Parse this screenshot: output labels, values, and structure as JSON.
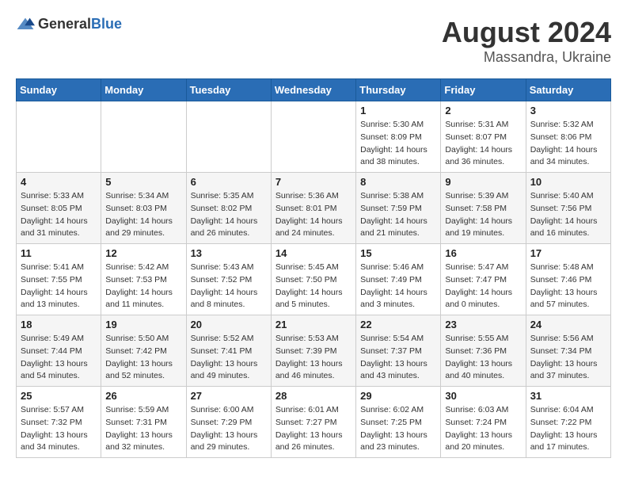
{
  "header": {
    "logo_general": "General",
    "logo_blue": "Blue",
    "month_year": "August 2024",
    "location": "Massandra, Ukraine"
  },
  "weekdays": [
    "Sunday",
    "Monday",
    "Tuesday",
    "Wednesday",
    "Thursday",
    "Friday",
    "Saturday"
  ],
  "weeks": [
    [
      {
        "day": "",
        "sunrise": "",
        "sunset": "",
        "daylight": ""
      },
      {
        "day": "",
        "sunrise": "",
        "sunset": "",
        "daylight": ""
      },
      {
        "day": "",
        "sunrise": "",
        "sunset": "",
        "daylight": ""
      },
      {
        "day": "",
        "sunrise": "",
        "sunset": "",
        "daylight": ""
      },
      {
        "day": "1",
        "sunrise": "Sunrise: 5:30 AM",
        "sunset": "Sunset: 8:09 PM",
        "daylight": "Daylight: 14 hours and 38 minutes."
      },
      {
        "day": "2",
        "sunrise": "Sunrise: 5:31 AM",
        "sunset": "Sunset: 8:07 PM",
        "daylight": "Daylight: 14 hours and 36 minutes."
      },
      {
        "day": "3",
        "sunrise": "Sunrise: 5:32 AM",
        "sunset": "Sunset: 8:06 PM",
        "daylight": "Daylight: 14 hours and 34 minutes."
      }
    ],
    [
      {
        "day": "4",
        "sunrise": "Sunrise: 5:33 AM",
        "sunset": "Sunset: 8:05 PM",
        "daylight": "Daylight: 14 hours and 31 minutes."
      },
      {
        "day": "5",
        "sunrise": "Sunrise: 5:34 AM",
        "sunset": "Sunset: 8:03 PM",
        "daylight": "Daylight: 14 hours and 29 minutes."
      },
      {
        "day": "6",
        "sunrise": "Sunrise: 5:35 AM",
        "sunset": "Sunset: 8:02 PM",
        "daylight": "Daylight: 14 hours and 26 minutes."
      },
      {
        "day": "7",
        "sunrise": "Sunrise: 5:36 AM",
        "sunset": "Sunset: 8:01 PM",
        "daylight": "Daylight: 14 hours and 24 minutes."
      },
      {
        "day": "8",
        "sunrise": "Sunrise: 5:38 AM",
        "sunset": "Sunset: 7:59 PM",
        "daylight": "Daylight: 14 hours and 21 minutes."
      },
      {
        "day": "9",
        "sunrise": "Sunrise: 5:39 AM",
        "sunset": "Sunset: 7:58 PM",
        "daylight": "Daylight: 14 hours and 19 minutes."
      },
      {
        "day": "10",
        "sunrise": "Sunrise: 5:40 AM",
        "sunset": "Sunset: 7:56 PM",
        "daylight": "Daylight: 14 hours and 16 minutes."
      }
    ],
    [
      {
        "day": "11",
        "sunrise": "Sunrise: 5:41 AM",
        "sunset": "Sunset: 7:55 PM",
        "daylight": "Daylight: 14 hours and 13 minutes."
      },
      {
        "day": "12",
        "sunrise": "Sunrise: 5:42 AM",
        "sunset": "Sunset: 7:53 PM",
        "daylight": "Daylight: 14 hours and 11 minutes."
      },
      {
        "day": "13",
        "sunrise": "Sunrise: 5:43 AM",
        "sunset": "Sunset: 7:52 PM",
        "daylight": "Daylight: 14 hours and 8 minutes."
      },
      {
        "day": "14",
        "sunrise": "Sunrise: 5:45 AM",
        "sunset": "Sunset: 7:50 PM",
        "daylight": "Daylight: 14 hours and 5 minutes."
      },
      {
        "day": "15",
        "sunrise": "Sunrise: 5:46 AM",
        "sunset": "Sunset: 7:49 PM",
        "daylight": "Daylight: 14 hours and 3 minutes."
      },
      {
        "day": "16",
        "sunrise": "Sunrise: 5:47 AM",
        "sunset": "Sunset: 7:47 PM",
        "daylight": "Daylight: 14 hours and 0 minutes."
      },
      {
        "day": "17",
        "sunrise": "Sunrise: 5:48 AM",
        "sunset": "Sunset: 7:46 PM",
        "daylight": "Daylight: 13 hours and 57 minutes."
      }
    ],
    [
      {
        "day": "18",
        "sunrise": "Sunrise: 5:49 AM",
        "sunset": "Sunset: 7:44 PM",
        "daylight": "Daylight: 13 hours and 54 minutes."
      },
      {
        "day": "19",
        "sunrise": "Sunrise: 5:50 AM",
        "sunset": "Sunset: 7:42 PM",
        "daylight": "Daylight: 13 hours and 52 minutes."
      },
      {
        "day": "20",
        "sunrise": "Sunrise: 5:52 AM",
        "sunset": "Sunset: 7:41 PM",
        "daylight": "Daylight: 13 hours and 49 minutes."
      },
      {
        "day": "21",
        "sunrise": "Sunrise: 5:53 AM",
        "sunset": "Sunset: 7:39 PM",
        "daylight": "Daylight: 13 hours and 46 minutes."
      },
      {
        "day": "22",
        "sunrise": "Sunrise: 5:54 AM",
        "sunset": "Sunset: 7:37 PM",
        "daylight": "Daylight: 13 hours and 43 minutes."
      },
      {
        "day": "23",
        "sunrise": "Sunrise: 5:55 AM",
        "sunset": "Sunset: 7:36 PM",
        "daylight": "Daylight: 13 hours and 40 minutes."
      },
      {
        "day": "24",
        "sunrise": "Sunrise: 5:56 AM",
        "sunset": "Sunset: 7:34 PM",
        "daylight": "Daylight: 13 hours and 37 minutes."
      }
    ],
    [
      {
        "day": "25",
        "sunrise": "Sunrise: 5:57 AM",
        "sunset": "Sunset: 7:32 PM",
        "daylight": "Daylight: 13 hours and 34 minutes."
      },
      {
        "day": "26",
        "sunrise": "Sunrise: 5:59 AM",
        "sunset": "Sunset: 7:31 PM",
        "daylight": "Daylight: 13 hours and 32 minutes."
      },
      {
        "day": "27",
        "sunrise": "Sunrise: 6:00 AM",
        "sunset": "Sunset: 7:29 PM",
        "daylight": "Daylight: 13 hours and 29 minutes."
      },
      {
        "day": "28",
        "sunrise": "Sunrise: 6:01 AM",
        "sunset": "Sunset: 7:27 PM",
        "daylight": "Daylight: 13 hours and 26 minutes."
      },
      {
        "day": "29",
        "sunrise": "Sunrise: 6:02 AM",
        "sunset": "Sunset: 7:25 PM",
        "daylight": "Daylight: 13 hours and 23 minutes."
      },
      {
        "day": "30",
        "sunrise": "Sunrise: 6:03 AM",
        "sunset": "Sunset: 7:24 PM",
        "daylight": "Daylight: 13 hours and 20 minutes."
      },
      {
        "day": "31",
        "sunrise": "Sunrise: 6:04 AM",
        "sunset": "Sunset: 7:22 PM",
        "daylight": "Daylight: 13 hours and 17 minutes."
      }
    ]
  ]
}
